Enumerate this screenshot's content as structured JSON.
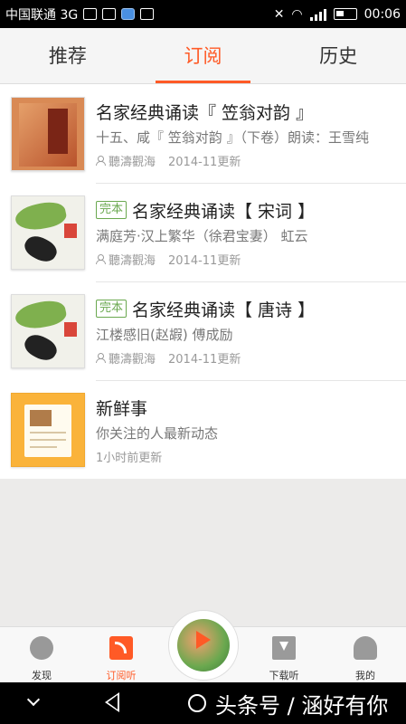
{
  "status_bar": {
    "carrier": "中国联通 3G",
    "time": "00:06",
    "network": "3G"
  },
  "tabs": [
    {
      "label": "推荐",
      "active": false
    },
    {
      "label": "订阅",
      "active": true
    },
    {
      "label": "历史",
      "active": false
    }
  ],
  "subscriptions": [
    {
      "cover": "book-cover-red",
      "badge": "",
      "title": "名家经典诵读『 笠翁对韵 』",
      "subtitle": "十五、咸『 笠翁对韵 』（下卷）朗读：王雪纯",
      "author": "聽濤觀海",
      "updated": "2014-11更新"
    },
    {
      "cover": "book-cover-fish",
      "badge": "完本",
      "title": "名家经典诵读【 宋词 】",
      "subtitle": "满庭芳·汉上繁华（徐君宝妻） 虹云",
      "author": "聽濤觀海",
      "updated": "2014-11更新"
    },
    {
      "cover": "book-cover-fish",
      "badge": "完本",
      "title": "名家经典诵读【 唐诗 】",
      "subtitle": "江楼感旧(赵嘏) 傅成励",
      "author": "聽濤觀海",
      "updated": "2014-11更新"
    },
    {
      "cover": "news-icon",
      "badge": "",
      "title": "新鲜事",
      "subtitle": "你关注的人最新动态",
      "author": "",
      "updated": "1小时前更新"
    }
  ],
  "bottom_nav": [
    {
      "label": "发现",
      "icon": "planet-icon",
      "active": false
    },
    {
      "label": "订阅听",
      "icon": "rss-icon",
      "active": true
    },
    {
      "label": "下载听",
      "icon": "download-icon",
      "active": false
    },
    {
      "label": "我的",
      "icon": "profile-icon",
      "active": false
    }
  ],
  "watermark": "头条号 / 涵好有你",
  "colors": {
    "accent": "#ff5a26",
    "badge_green": "#6aa84f"
  }
}
